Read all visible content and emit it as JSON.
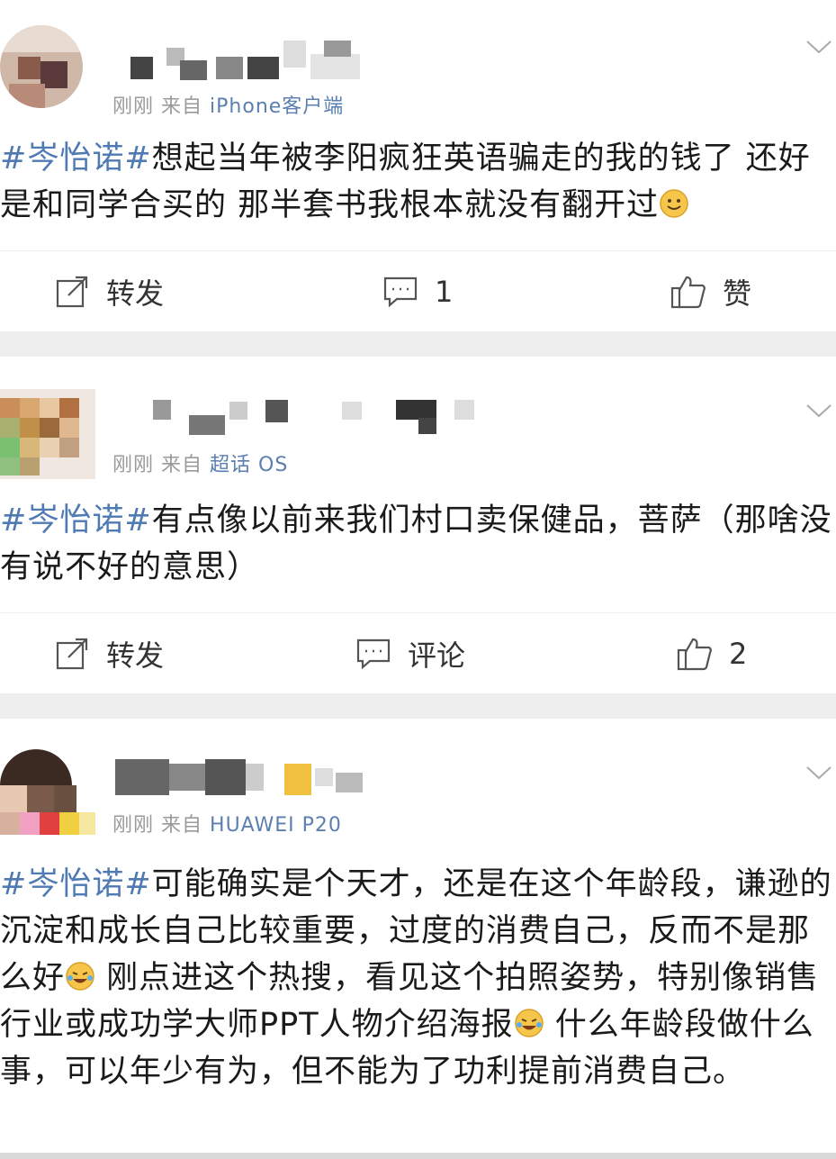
{
  "posts": [
    {
      "meta": {
        "time": "刚刚",
        "from": "来自",
        "source": "iPhone客户端"
      },
      "hashtag": "#岑怡诺#",
      "text": "想起当年被李阳疯狂英语骗走的我的钱了 还好是和同学合买的 那半套书我根本就没有翻开过",
      "emoji": "smile-emoji",
      "actions": {
        "repost": "转发",
        "comment": "1",
        "like": "赞"
      }
    },
    {
      "meta": {
        "time": "刚刚",
        "from": "来自",
        "source": "超话 OS"
      },
      "hashtag": "#岑怡诺#",
      "text": "有点像以前来我们村口卖保健品，菩萨（那啥没有说不好的意思）",
      "actions": {
        "repost": "转发",
        "comment": "评论",
        "like": "2"
      }
    },
    {
      "meta": {
        "time": "刚刚",
        "from": "来自",
        "source": "HUAWEI P20"
      },
      "hashtag": "#岑怡诺#",
      "text_parts": [
        "可能确实是个天才，还是在这个年龄段，谦逊的沉淀和成长自己比较重要，过度的消费自己，反而不是那么好",
        " 刚点进这个热搜，看见这个拍照姿势，特别像销售行业或成功学大师PPT人物介绍海报",
        " 什么年龄段做什么事，可以年少有为，但不能为了功利提前消费自己。"
      ],
      "emoji": "laughing-tears-emoji"
    }
  ],
  "colors": {
    "hashtag": "#4f7ab3",
    "separator": "#eeeeee",
    "meta": "#9a9a9a"
  }
}
